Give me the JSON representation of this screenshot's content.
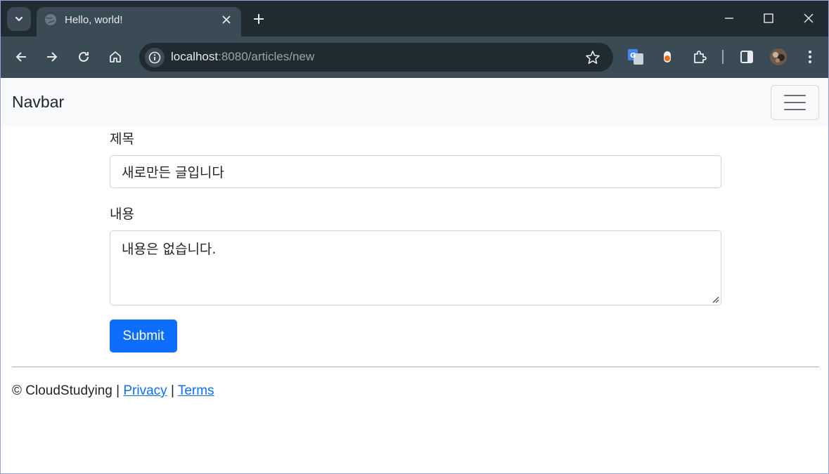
{
  "browser": {
    "tab_title": "Hello, world!",
    "url_host": "localhost",
    "url_path": ":8080/articles/new",
    "icons": {
      "tab_search": "chevron-down-icon",
      "favicon": "globe-icon",
      "tab_close": "close-icon",
      "new_tab": "plus-icon",
      "minimize": "minimize-icon",
      "maximize": "maximize-icon",
      "close_window": "close-window-icon",
      "back": "back-arrow-icon",
      "forward": "forward-arrow-icon",
      "reload": "reload-icon",
      "home": "home-icon",
      "site_info": "info-icon",
      "bookmark": "star-icon",
      "translate": "translate-icon",
      "extension1": "extension-icon",
      "extensions": "puzzle-icon",
      "side_panel": "side-panel-icon",
      "profile": "avatar",
      "menu": "kebab-menu-icon"
    }
  },
  "navbar": {
    "brand": "Navbar",
    "toggler_icon": "hamburger-icon"
  },
  "form": {
    "title_label": "제목",
    "title_value": "새로만든 글입니다",
    "content_label": "내용",
    "content_value": "내용은 없습니다.",
    "submit_label": "Submit"
  },
  "footer": {
    "copyright": "© CloudStudying |",
    "privacy": "Privacy",
    "separator": "|",
    "terms": "Terms"
  },
  "colors": {
    "primary": "#0d6efd",
    "navbar_bg": "#f8f9fa",
    "chrome_dark": "#202a31",
    "chrome_toolbar": "#3a4b56"
  }
}
